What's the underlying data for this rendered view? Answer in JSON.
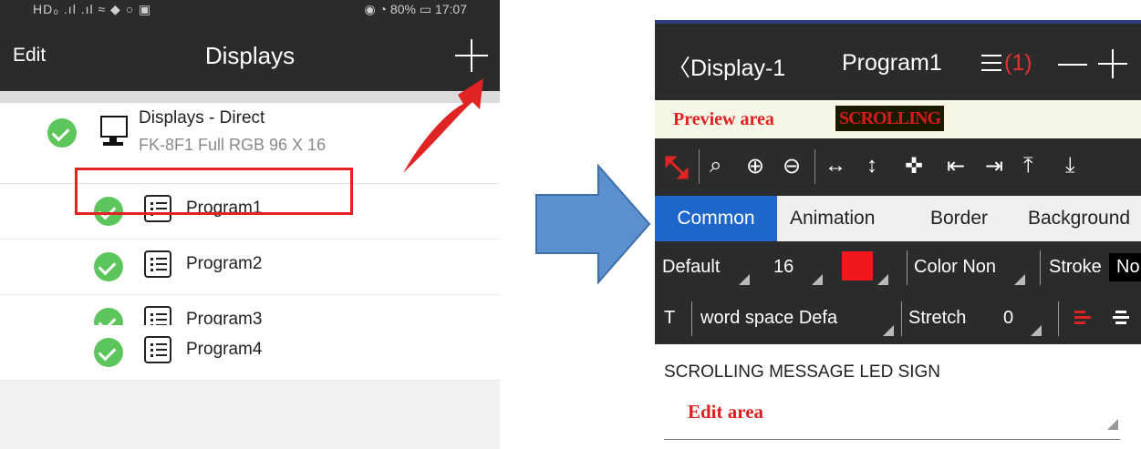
{
  "left_screen": {
    "status_left": "HD₀ .ıl .ıl ≈ ◆ ○ ▣",
    "status_right": "◉ ◔ 80% ▭ 17:07",
    "edit_label": "Edit",
    "title": "Displays",
    "add_icon": "plus-icon",
    "display": {
      "name": "Displays - Direct",
      "details": "FK-8F1   Full RGB   96 X 16",
      "icon": "monitor-icon",
      "status_icon": "check-circle-icon"
    },
    "programs": [
      {
        "label": "Program1",
        "highlighted": true
      },
      {
        "label": "Program2"
      },
      {
        "label": "Program3"
      },
      {
        "label": "Program4"
      }
    ],
    "annotation_colors": {
      "highlight_box": "#e02424",
      "pointer_arrow": "#e02424"
    }
  },
  "arrow": {
    "color": "#5b8fd0"
  },
  "right_screen": {
    "back_label": "〈Display-1",
    "program_title": "Program1",
    "menu_icon": "hamburger-icon",
    "program_count": "(1)",
    "preview": {
      "label": "Preview area",
      "led_text": "SCROLLING"
    },
    "tool_icons": [
      "resize-icon",
      "search-icon",
      "zoom-in-icon",
      "zoom-out-icon",
      "width-icon",
      "height-icon",
      "move-icon",
      "align-left-icon",
      "align-right-icon",
      "align-top-icon",
      "align-bottom-icon"
    ],
    "tabs": [
      "Common",
      "Animation",
      "Border",
      "Background"
    ],
    "active_tab": "Common",
    "font_row": {
      "font": "Default",
      "size": "16",
      "color_swatch": "#f0161a",
      "color_mode": "Color Non",
      "stroke_label": "Stroke",
      "stroke_value": "No"
    },
    "spacing_row": {
      "text_icon": "T",
      "word_space": "word space Defa",
      "stretch_label": "Stretch",
      "stretch_value": "0"
    },
    "edit": {
      "text": "SCROLLING MESSAGE LED SIGN",
      "label": "Edit area"
    }
  }
}
